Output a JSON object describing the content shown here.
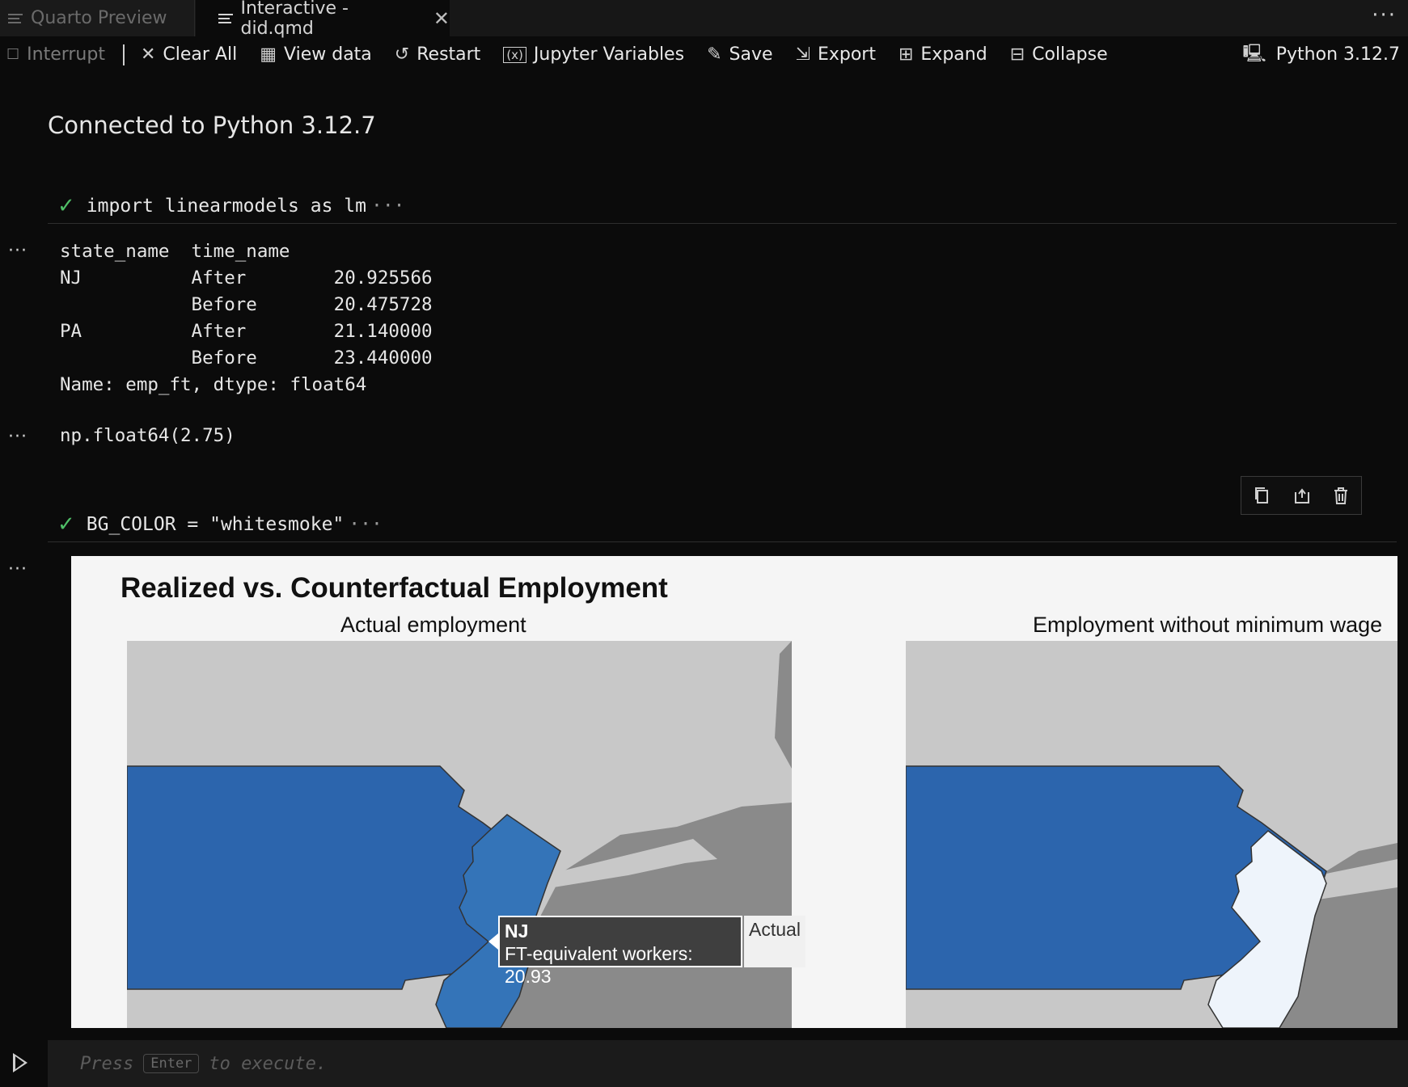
{
  "tabs": [
    {
      "label": "Quarto Preview",
      "active": false
    },
    {
      "label": "Interactive - did.qmd",
      "active": true
    }
  ],
  "toolbar": {
    "interrupt": "Interrupt",
    "clear_all": "Clear All",
    "view_data": "View data",
    "restart": "Restart",
    "jupyter_variables": "Jupyter Variables",
    "save": "Save",
    "export": "Export",
    "expand": "Expand",
    "collapse": "Collapse",
    "kernel": "Python 3.12.7"
  },
  "connected": "Connected to Python 3.12.7",
  "cells": [
    {
      "code": "import linearmodels as lm",
      "status": "success"
    },
    {
      "code": "BG_COLOR = \"whitesmoke\"",
      "status": "success"
    }
  ],
  "output1": {
    "header": "state_name  time_name",
    "rows": [
      "NJ          After        20.925566",
      "            Before       20.475728",
      "PA          After        21.140000",
      "            Before       23.440000"
    ],
    "footer": "Name: emp_ft, dtype: float64"
  },
  "output2": "np.float64(2.75)",
  "figure": {
    "title": "Realized vs. Counterfactual Employment",
    "subtitle_left": "Actual employment",
    "subtitle_right": "Employment without minimum wage",
    "tooltip": {
      "name": "NJ",
      "value": "FT-equivalent workers: 20.93",
      "extra": "Actual"
    },
    "colors": {
      "pa": "#2c65ad",
      "nj_actual": "#3474b8",
      "nj_counter": "#eef4fb",
      "land": "#8a8a8a",
      "water": "#c8c8c8"
    }
  },
  "input": {
    "prefix": "Press",
    "key": "Enter",
    "suffix": "to execute."
  }
}
